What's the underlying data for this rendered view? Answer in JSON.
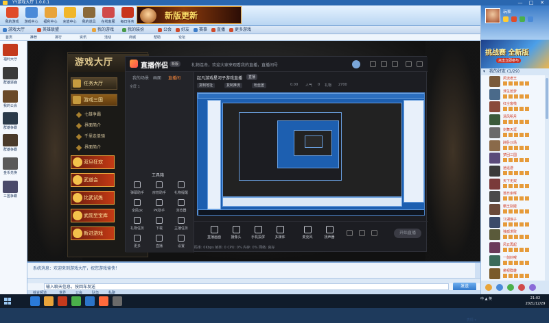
{
  "window": {
    "title": "YY游戏大厅 1.0.0.1",
    "controls": [
      "—",
      "□",
      "✕"
    ]
  },
  "toolbar": {
    "items": [
      {
        "label": "我的游戏",
        "icon": "game-icon",
        "color": "#e04b2a"
      },
      {
        "label": "游戏中心",
        "icon": "center-icon",
        "color": "#4a8ad8"
      },
      {
        "label": "福利中心",
        "icon": "gift-icon",
        "color": "#e8a43a"
      },
      {
        "label": "充值中心",
        "icon": "coin-icon",
        "color": "#f0b62a"
      },
      {
        "label": "我的道具",
        "icon": "hammer-icon",
        "color": "#8a6a3a"
      },
      {
        "label": "在线客服",
        "icon": "cs-icon",
        "color": "#d04a4a"
      },
      {
        "label": "每日任务",
        "icon": "chest-icon",
        "color": "#c8341c"
      }
    ],
    "banner_text": "新版更新"
  },
  "tabs": [
    {
      "label": "游戏大厅",
      "color": "#3c7cc8"
    },
    {
      "label": "英雄联盟",
      "color": "#d04a2a"
    },
    {
      "label": "我的游戏",
      "color": "#e8a43a"
    },
    {
      "label": "我的装扮",
      "color": "#4a9a4a"
    },
    {
      "label": "公会",
      "color": "#d04a2a"
    },
    {
      "label": "好友",
      "color": "#d04a2a"
    },
    {
      "label": "赛事",
      "color": "#3c7cc8"
    },
    {
      "label": "直播",
      "color": "#d04a2a"
    },
    {
      "label": "更多游戏",
      "color": "#d04a2a"
    }
  ],
  "substrip": [
    "首页",
    "推荐",
    "排行",
    "资讯",
    "活动",
    "商城",
    "帮助",
    "论坛"
  ],
  "left_sidebar": [
    {
      "label": "福利大厅",
      "color": "#c43a1c"
    },
    {
      "label": "群雄逐鹿",
      "color": "#3a3a3a"
    },
    {
      "label": "我的公会",
      "color": "#6a4a2a"
    },
    {
      "label": "群雄争霸",
      "color": "#2a3a4a"
    },
    {
      "label": "群雄争霸",
      "color": "#4a3a2a"
    },
    {
      "label": "金币兑换",
      "color": "#5a5a5a"
    },
    {
      "label": "三国争霸",
      "color": "#4a4a6a"
    }
  ],
  "lobby": {
    "title": "游戏大厅",
    "rows": [
      "任务大厅",
      "游戏三国"
    ],
    "subs": [
      "七雄争霸",
      "界面简介",
      "千里走单骑",
      "界面简介"
    ],
    "tiles": [
      "双旦狂欢",
      "武道会",
      "比武试炼",
      "武勋至宝库",
      "新进游戏"
    ]
  },
  "stream": {
    "brand": "直播伴侣",
    "version": "新版",
    "notice": "礼物连击，欢迎大家来观看我的直播，直播间号",
    "side_tabs": [
      "我的场景",
      "画面",
      "直播间"
    ],
    "scene_rows": [
      "全屏 1"
    ],
    "tools_heading": "工具箱",
    "tools": [
      [
        "弹幕助手",
        "房管助手",
        "礼物提醒"
      ],
      [
        "全民pk",
        "PK助手",
        "浏览器"
      ],
      [
        "礼物任务",
        "下载",
        "主播任务"
      ],
      [
        "更多",
        "直播",
        "设置"
      ]
    ],
    "room_name": "起凡游戏星河子游戏直播",
    "room_tag": "直播",
    "chips": [
      "复制地址",
      "复制推流",
      "粉丝团"
    ],
    "stats": [
      "0.00",
      "人气",
      "0",
      "礼物",
      "2700"
    ],
    "bottom_buttons": [
      "直播画面",
      "摄像头",
      "手机投屏",
      "多媒体",
      "麦克风",
      "扬声器"
    ],
    "start_live": "开始直播",
    "status_line": "码率: 0Kbps   帧率: 0   CPU: 0%   内存: 0%   网络: 良好"
  },
  "chat": {
    "message": "系统消息：欢迎来到游戏大厅，祝您游戏愉快！",
    "input_placeholder": "输入聊天信息，按回车发送",
    "send": "发送",
    "bottom": [
      "综合频道",
      "世界",
      "公会",
      "队伍",
      "私聊"
    ],
    "right_label": "表情 ▾"
  },
  "right_panel": {
    "profile_name": "玩家",
    "ad_title": "挑战赛 全新版",
    "ad_sub": "点击立即参与",
    "friends_head": "我的好友 (1/29)",
    "friends": [
      {
        "name": "风流老王",
        "color": "#7a5a3a"
      },
      {
        "name": "浮生若梦",
        "color": "#4a6a8a"
      },
      {
        "name": "红尘客栈",
        "color": "#8a4a3a"
      },
      {
        "name": "清风明月",
        "color": "#3a5a3a"
      },
      {
        "name": "剑舞天涯",
        "color": "#6a6a6a"
      },
      {
        "name": "醉卧沙场",
        "color": "#8a6a4a"
      },
      {
        "name": "梦回三国",
        "color": "#5a4a7a"
      },
      {
        "name": "逍遥游",
        "color": "#3a3a3a"
      },
      {
        "name": "天下无双",
        "color": "#7a3a3a"
      },
      {
        "name": "落日余晖",
        "color": "#4a4a4a"
      },
      {
        "name": "霸王别姬",
        "color": "#6a4a3a"
      },
      {
        "name": "江湖浪子",
        "color": "#3a4a6a"
      },
      {
        "name": "独孤求败",
        "color": "#5a5a3a"
      },
      {
        "name": "风云再起",
        "color": "#6a3a5a"
      },
      {
        "name": "一剑封喉",
        "color": "#3a6a5a"
      },
      {
        "name": "傲视群雄",
        "color": "#7a5a2a"
      }
    ]
  },
  "taskbar": {
    "time": "21:02",
    "date": "2021/12/29",
    "tray": "中 ▲ 英"
  }
}
